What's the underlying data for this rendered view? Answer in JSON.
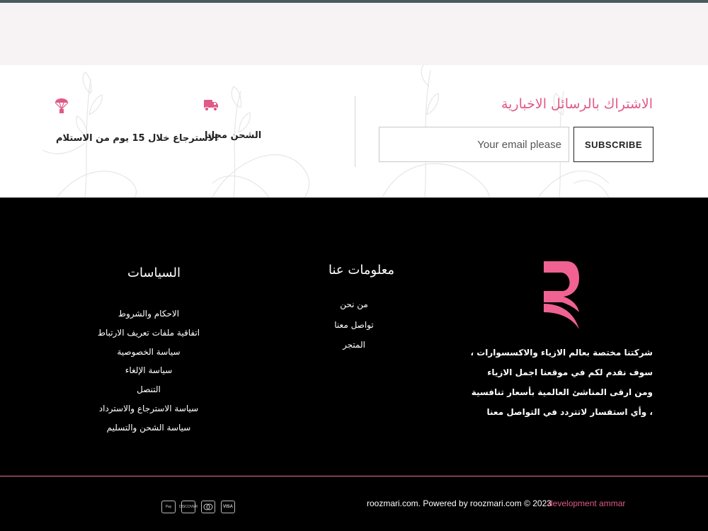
{
  "newsletter": {
    "title": "الاشتراك بالرسائل الاخبارية",
    "email_placeholder": "Your email please",
    "subscribe_label": "SUBSCRIBE"
  },
  "features": [
    {
      "icon": "truck-icon",
      "label": "الشحن مجانا"
    },
    {
      "icon": "parachute-icon",
      "label": "الاسترجاع خلال 15 يوم من الاستلام"
    }
  ],
  "about": {
    "text": "شركتنا مختصة بعالم الازياء والاكسسوارات ، سوف نقدم لكم في موقعنا اجمل الازياء ومن ارقى المناشئ العالمية بأسعار تنافسية ، وأي استفسار لاتتردد في التواصل معنا"
  },
  "about_us": {
    "title": "معلومات عنا",
    "links": [
      "من نحن",
      "تواصل معنا",
      "المتجر"
    ]
  },
  "policies": {
    "title": "السياسات",
    "links": [
      "الاحكام والشروط",
      "اتفاقية ملفات تعريف الارتباط",
      "سياسة الخصوصية",
      "سياسة الإلغاء",
      "التنصل",
      "سياسة الاسترجاع والاسترداد",
      "سياسة الشحن والتسليم"
    ]
  },
  "bottom": {
    "copyright": "roozmari.com. Powered by roozmari.com  © 2023",
    "dev_credit": "development ammar",
    "payment_icons": [
      {
        "name": "apple-pay-icon",
        "label": "Pay"
      },
      {
        "name": "discover-icon",
        "label": "DISCOVER"
      },
      {
        "name": "mastercard-icon",
        "label": ""
      },
      {
        "name": "visa-icon",
        "label": "VISA"
      }
    ]
  },
  "colors": {
    "accent": "#e05a86",
    "logo_pink": "#f06292",
    "footer_bg": "#000000",
    "strip_bg": "#f7f3f4"
  }
}
